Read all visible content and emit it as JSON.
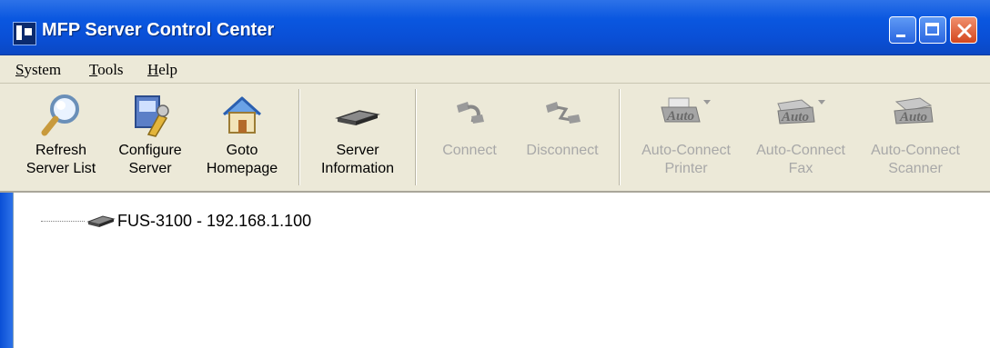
{
  "window": {
    "title": "MFP Server Control Center"
  },
  "menu": {
    "items": [
      "System",
      "Tools",
      "Help"
    ]
  },
  "toolbar": {
    "buttons": [
      {
        "label": "Refresh\nServer List",
        "icon": "magnifier-icon",
        "enabled": true
      },
      {
        "label": "Configure\nServer",
        "icon": "configure-icon",
        "enabled": true
      },
      {
        "label": "Goto\nHomepage",
        "icon": "home-icon",
        "enabled": true
      },
      {
        "label": "Server\nInformation",
        "icon": "server-device-icon",
        "enabled": true
      },
      {
        "label": "Connect",
        "icon": "connect-icon",
        "enabled": false
      },
      {
        "label": "Disconnect",
        "icon": "disconnect-icon",
        "enabled": false
      },
      {
        "label": "Auto-Connect\nPrinter",
        "icon": "auto-printer-icon",
        "icon_text": "Auto",
        "enabled": false
      },
      {
        "label": "Auto-Connect\nFax",
        "icon": "auto-fax-icon",
        "icon_text": "Auto",
        "enabled": false
      },
      {
        "label": "Auto-Connect\nScanner",
        "icon": "auto-scanner-icon",
        "icon_text": "Auto",
        "enabled": false
      }
    ]
  },
  "tree": {
    "nodes": [
      {
        "label": "FUS-3100 - 192.168.1.100",
        "icon": "server-device-icon"
      }
    ]
  },
  "colors": {
    "titlebar": "#0a57e0",
    "chrome": "#ece9d8",
    "disabled_text": "#a8a8a8"
  }
}
